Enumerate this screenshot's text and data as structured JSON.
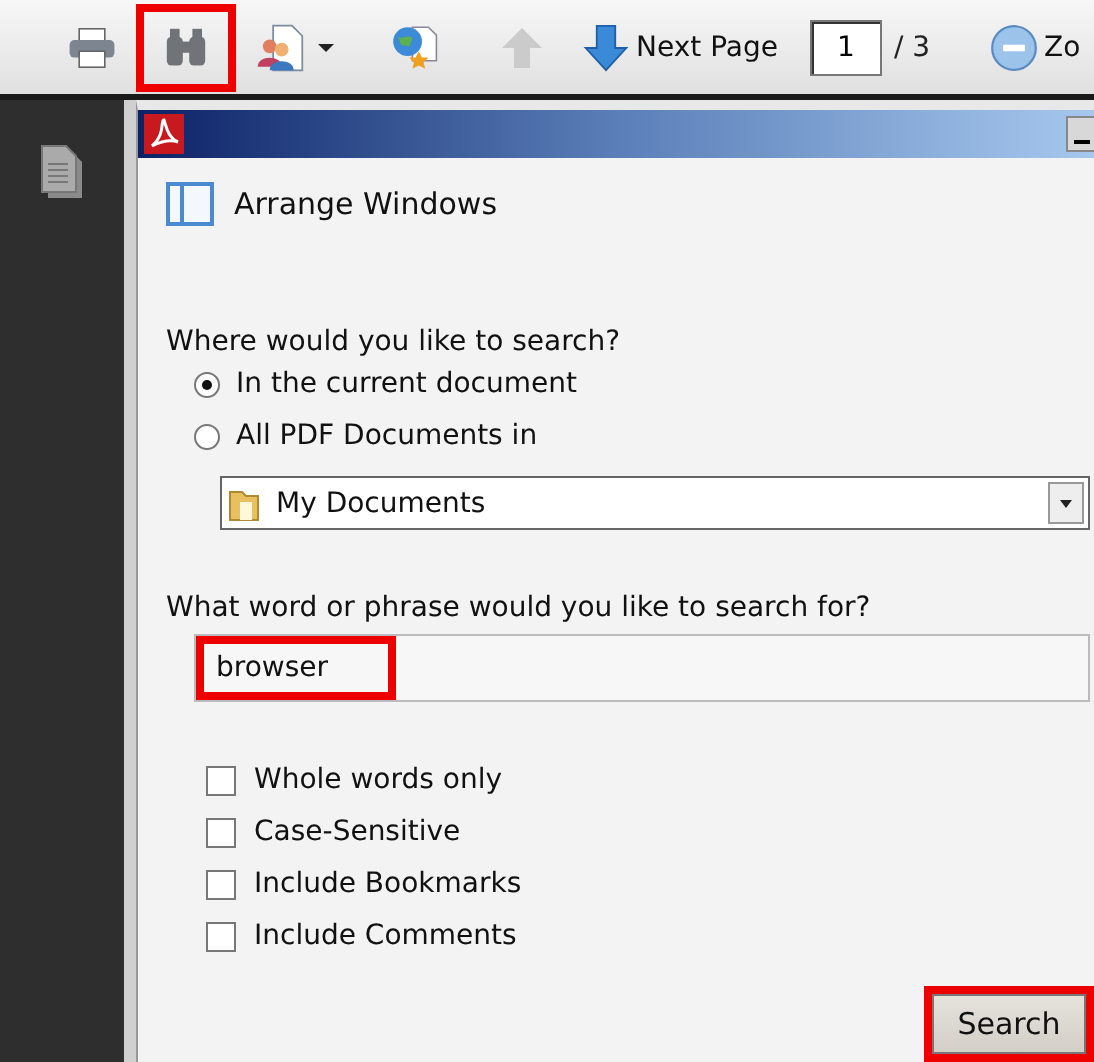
{
  "toolbar": {
    "items": [
      {
        "kind": "grip"
      },
      {
        "kind": "tool",
        "highlighted": false
      },
      {
        "kind": "tool",
        "highlighted": true
      },
      {
        "kind": "tool",
        "highlighted": false
      },
      {
        "kind": "separator"
      },
      {
        "kind": "tool",
        "highlighted": false
      },
      {
        "kind": "grip"
      },
      {
        "kind": "tool",
        "disabled": true,
        "highlighted": false
      },
      {
        "kind": "tool",
        "label": "Next Page",
        "highlighted": false
      },
      {
        "kind": "page",
        "value": "1",
        "total": "/ 3"
      },
      {
        "kind": "grip"
      },
      {
        "kind": "tool",
        "label": "Zo",
        "highlighted": false
      }
    ]
  },
  "dialog": {
    "arrange_windows": "Arrange Windows",
    "where_label": "Where would you like to search?",
    "scopes": [
      {
        "label": "In the current document",
        "selected": true
      },
      {
        "label": "All PDF Documents in",
        "selected": false
      }
    ],
    "folder": "My Documents",
    "phrase_label": "What word or phrase would you like to search for?",
    "phrase": {
      "value": "browser",
      "highlighted": true
    },
    "options": [
      {
        "label": "Whole words only",
        "checked": false
      },
      {
        "label": "Case-Sensitive",
        "checked": false
      },
      {
        "label": "Include Bookmarks",
        "checked": false
      },
      {
        "label": "Include Comments",
        "checked": false
      }
    ],
    "search_button": {
      "label": "Search",
      "highlighted": true
    }
  }
}
